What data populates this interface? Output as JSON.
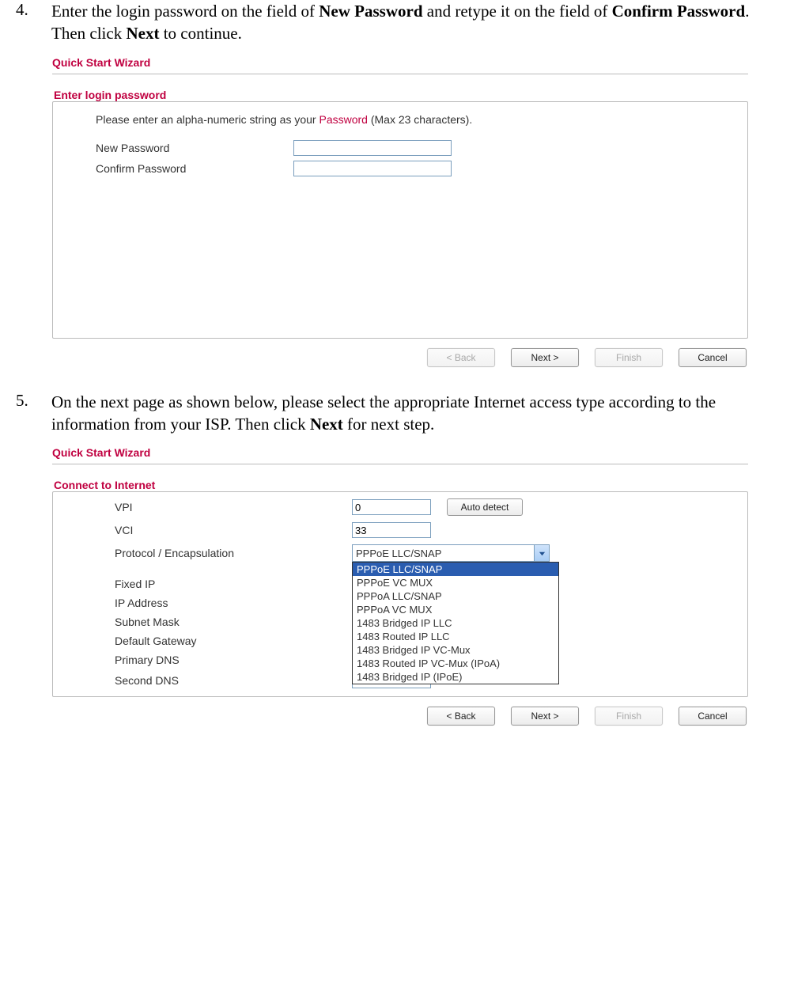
{
  "step4": {
    "number": "4.",
    "text_pre": "Enter the login password on the field of ",
    "bold1": "New Password",
    "text_mid": " and retype it on the field of ",
    "bold2": "Confirm Password",
    "text_after1": ". Then click ",
    "bold3": "Next",
    "text_after2": " to continue."
  },
  "wiz1": {
    "title": "Quick Start Wizard",
    "section": "Enter login password",
    "intro_pre": "Please enter an alpha-numeric string as your  ",
    "intro_pw": "Password",
    "intro_post": " (Max 23 characters).",
    "new_pw_label": "New Password",
    "confirm_pw_label": "Confirm Password",
    "new_pw_value": "",
    "confirm_pw_value": "",
    "btn_back": "< Back",
    "btn_next": "Next >",
    "btn_finish": "Finish",
    "btn_cancel": "Cancel"
  },
  "step5": {
    "number": "5.",
    "text_pre": "On the next page as shown below, please select the appropriate Internet access type according to the information from your ISP. Then click ",
    "bold1": "Next",
    "text_after": " for next step."
  },
  "wiz2": {
    "title": "Quick Start Wizard",
    "section": "Connect to Internet",
    "labels": {
      "vpi": "VPI",
      "vci": "VCI",
      "proto": "Protocol / Encapsulation",
      "fixed_ip": "Fixed IP",
      "ip_addr": "IP Address",
      "subnet": "Subnet Mask",
      "gateway": "Default Gateway",
      "pdns": "Primary DNS",
      "sdns": "Second DNS"
    },
    "values": {
      "vpi": "0",
      "vci": "33",
      "proto_selected": "PPPoE LLC/SNAP",
      "sdns": ""
    },
    "auto_detect": "Auto detect",
    "options": [
      "PPPoE LLC/SNAP",
      "PPPoE VC MUX",
      "PPPoA LLC/SNAP",
      "PPPoA VC MUX",
      "1483 Bridged IP LLC",
      "1483 Routed IP LLC",
      "1483 Bridged IP VC-Mux",
      "1483 Routed IP VC-Mux (IPoA)",
      "1483 Bridged IP (IPoE)"
    ],
    "btn_back": "< Back",
    "btn_next": "Next >",
    "btn_finish": "Finish",
    "btn_cancel": "Cancel"
  }
}
